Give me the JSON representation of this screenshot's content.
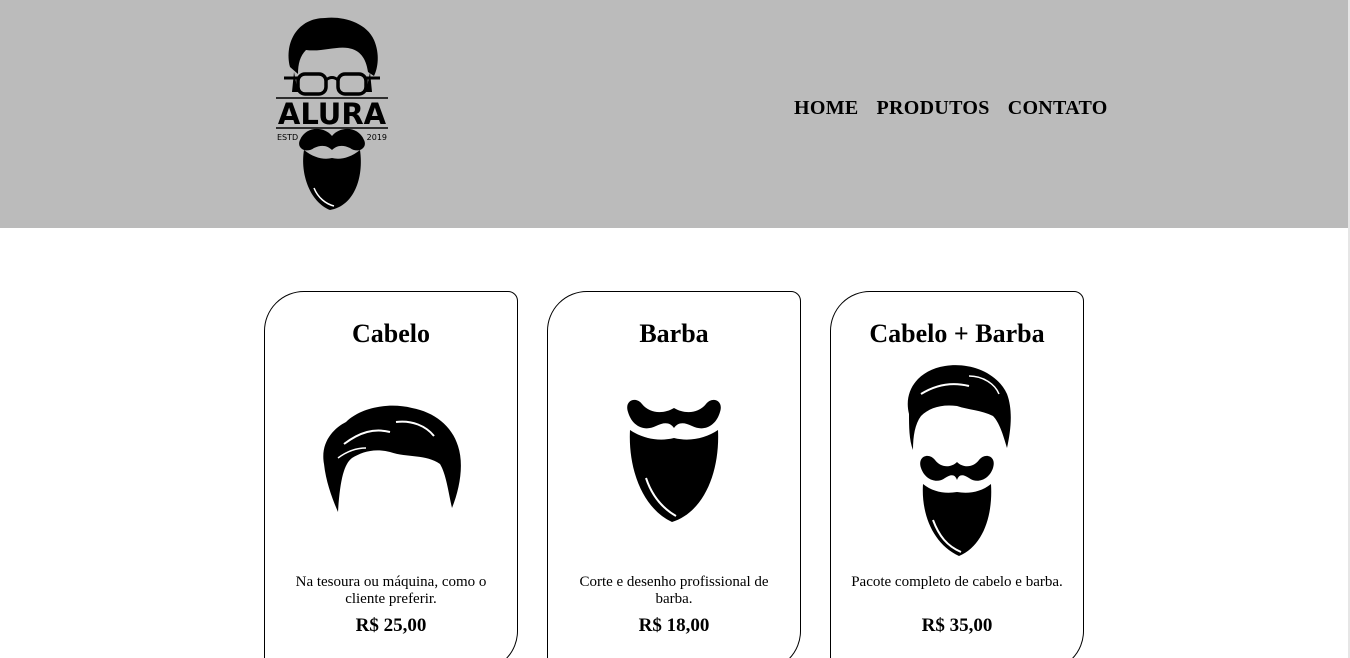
{
  "brand": {
    "name": "ALURA",
    "left_text": "ESTD",
    "right_text": "2019"
  },
  "nav": {
    "items": [
      "HOME",
      "PRODUTOS",
      "CONTATO"
    ]
  },
  "products": [
    {
      "title": "Cabelo",
      "icon": "hair-icon",
      "description": "Na tesoura ou máquina, como o cliente preferir.",
      "price": "R$ 25,00"
    },
    {
      "title": "Barba",
      "icon": "beard-icon",
      "description": "Corte e desenho profissional de barba.",
      "price": "R$ 18,00"
    },
    {
      "title": "Cabelo + Barba",
      "icon": "hair-and-beard-icon",
      "description": "Pacote completo de cabelo e barba.",
      "price": "R$ 35,00"
    }
  ],
  "colors": {
    "header_bg": "#bbbbbb",
    "text": "#000000",
    "page_bg": "#ffffff"
  }
}
